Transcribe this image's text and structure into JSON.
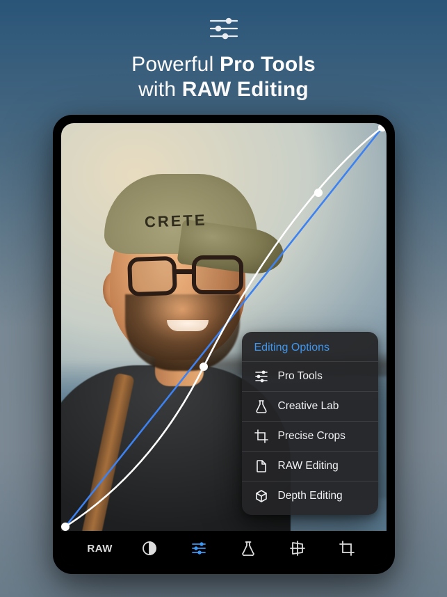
{
  "headline": {
    "pre": "Powerful ",
    "b1": "Pro Tools",
    "mid": "with ",
    "b2": "RAW Editing"
  },
  "cap_text": "CRETE",
  "popup": {
    "title": "Editing Options",
    "items": [
      {
        "label": "Pro Tools"
      },
      {
        "label": "Creative Lab"
      },
      {
        "label": "Precise Crops"
      },
      {
        "label": "RAW Editing"
      },
      {
        "label": "Depth Editing"
      }
    ]
  },
  "toolbar": {
    "raw_label": "RAW"
  }
}
